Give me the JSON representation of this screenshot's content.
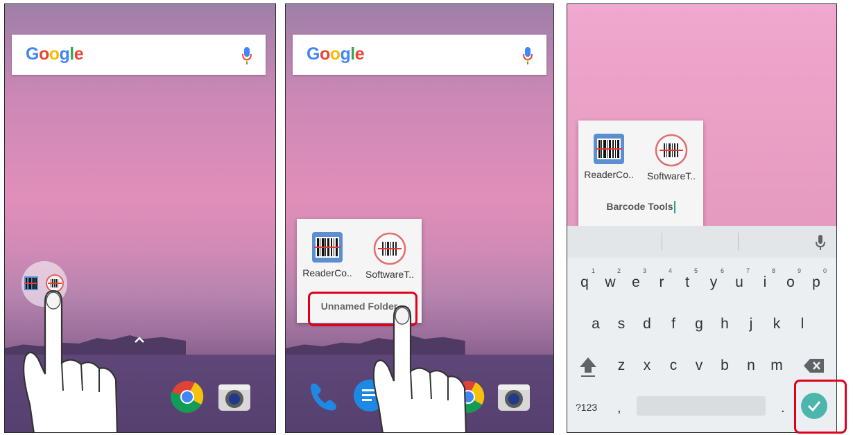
{
  "colors": {
    "accent": "#4db6ac",
    "highlight": "#e0001b",
    "chrome_red": "#db4437",
    "chrome_yellow": "#f4c20d",
    "chrome_green": "#0f9d58",
    "chrome_blue": "#4285f4"
  },
  "search": {
    "logo_letters": [
      "G",
      "o",
      "o",
      "g",
      "l",
      "e"
    ],
    "logo_colors": [
      "#4285f4",
      "#ea4335",
      "#fbbc05",
      "#4285f4",
      "#34a853",
      "#ea4335"
    ],
    "icon": "mic-icon"
  },
  "home": {
    "dock_apps": [
      {
        "name": "chrome-icon"
      },
      {
        "name": "camera-icon"
      }
    ],
    "chevron": "chevron-up-icon"
  },
  "step2": {
    "apps": [
      {
        "label": "ReaderCo..",
        "icon": "barcode-reader-icon"
      },
      {
        "label": "SoftwareT..",
        "icon": "barcode-scan-icon"
      }
    ],
    "folder_name": "Unnamed Folder",
    "dock_apps": [
      {
        "name": "phone-icon"
      },
      {
        "name": "messages-icon"
      },
      {
        "name": "chrome-icon"
      },
      {
        "name": "camera-icon"
      }
    ]
  },
  "step3": {
    "apps": [
      {
        "label": "ReaderCo..",
        "icon": "barcode-reader-icon"
      },
      {
        "label": "SoftwareT..",
        "icon": "barcode-scan-icon"
      }
    ],
    "folder_name": "Barcode Tools"
  },
  "keyboard": {
    "row1": [
      "q",
      "w",
      "e",
      "r",
      "t",
      "y",
      "u",
      "i",
      "o",
      "p"
    ],
    "row1_numbers": [
      "1",
      "2",
      "3",
      "4",
      "5",
      "6",
      "7",
      "8",
      "9",
      "0"
    ],
    "row2": [
      "a",
      "s",
      "d",
      "f",
      "g",
      "h",
      "j",
      "k",
      "l"
    ],
    "row3": [
      "z",
      "x",
      "c",
      "v",
      "b",
      "n",
      "m"
    ],
    "symbols_key": "?123",
    "comma_key": ",",
    "period_key": ".",
    "shift_icon": "shift-icon",
    "backspace_icon": "backspace-icon",
    "done_icon": "check-icon",
    "mic_icon": "mic-icon"
  }
}
